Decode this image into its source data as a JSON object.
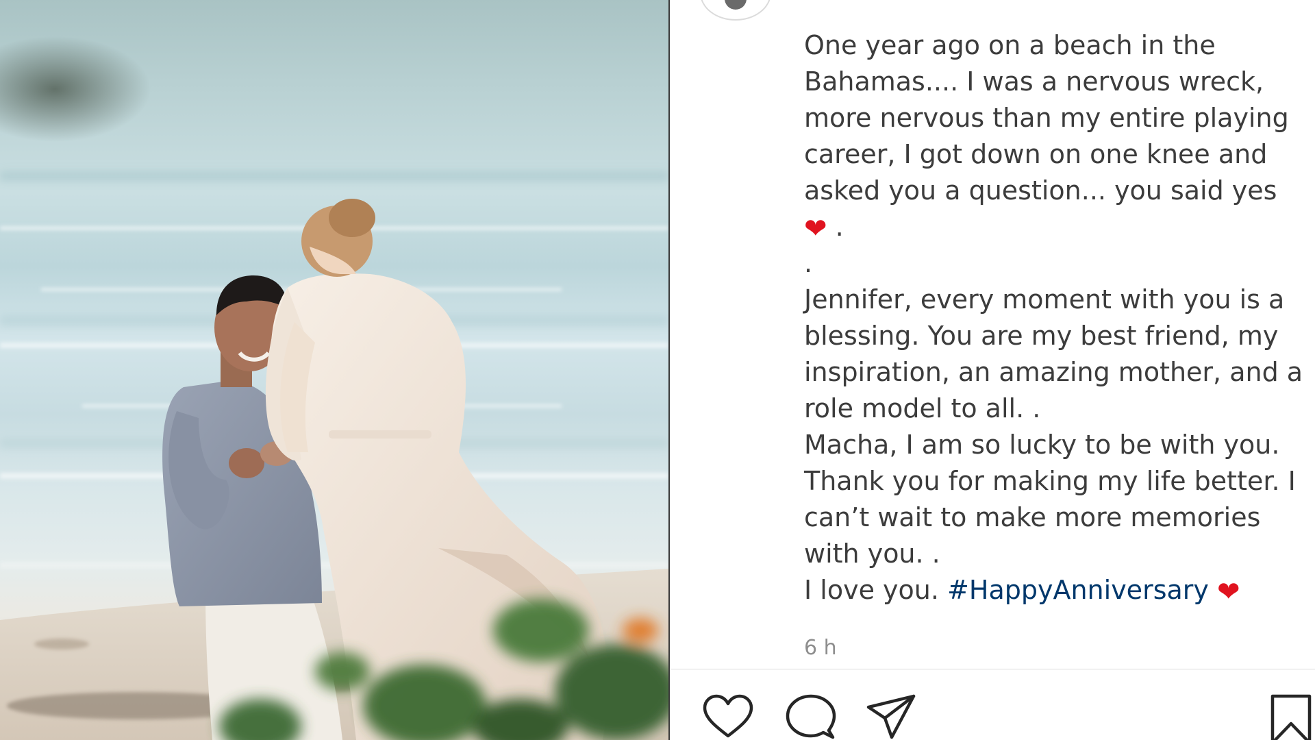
{
  "post": {
    "caption_lines": [
      "One year ago on a beach in the",
      "Bahamas.... I was a nervous wreck,",
      "more nervous than my entire playing",
      "career, I got down on one knee and",
      "asked you a question... you said yes",
      ".",
      "Jennifer, every moment with you is a",
      "blessing. You are my best friend, my",
      "inspiration, an amazing mother, and a",
      "role model to all. .",
      "Macha, I am so lucky to be with you.",
      "Thank you for making my life better. I",
      "can’t wait to make more memories",
      "with you. .",
      "I love you."
    ],
    "heart_line_suffix": ".",
    "heart_emoji": "❤",
    "hashtag": "#HappyAnniversary",
    "timestamp": "6 h"
  },
  "actions": {
    "like_icon": "heart-outline-icon",
    "comment_icon": "speech-bubble-icon",
    "share_icon": "paper-plane-icon",
    "save_icon": "bookmark-icon"
  },
  "colors": {
    "caption_text": "#3c3c3c",
    "hashtag": "#00376b",
    "heart": "#e0131f",
    "timestamp": "#8e8e8e",
    "separator": "#dbdbdb"
  }
}
